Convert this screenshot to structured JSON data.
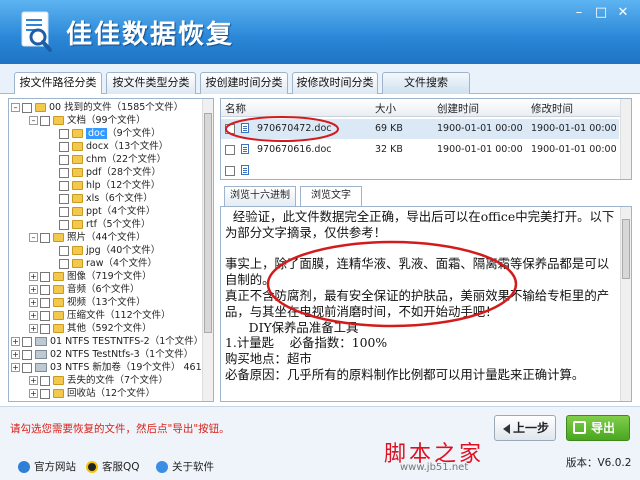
{
  "app": {
    "title": "佳佳数据恢复",
    "window_buttons": [
      "–",
      "□",
      "✕"
    ]
  },
  "tabs": [
    {
      "label": "按文件路径分类",
      "active": true
    },
    {
      "label": "按文件类型分类",
      "active": false
    },
    {
      "label": "按创建时间分类",
      "active": false
    },
    {
      "label": "按修改时间分类",
      "active": false
    },
    {
      "label": "文件搜索",
      "active": false
    }
  ],
  "tree": {
    "rows": [
      {
        "level": 0,
        "toggle": "–",
        "icon": "folder",
        "label": "00 找到的文件",
        "count": "（1585个文件）"
      },
      {
        "level": 1,
        "toggle": "–",
        "icon": "folder",
        "label": "文档",
        "count": "（99个文件）"
      },
      {
        "level": 2,
        "toggle": "",
        "icon": "folder",
        "label": "doc",
        "count": "（9个文件）",
        "selected": true
      },
      {
        "level": 2,
        "toggle": "",
        "icon": "folder",
        "label": "docx",
        "count": "（13个文件）"
      },
      {
        "level": 2,
        "toggle": "",
        "icon": "folder",
        "label": "chm",
        "count": "（22个文件）"
      },
      {
        "level": 2,
        "toggle": "",
        "icon": "folder",
        "label": "pdf",
        "count": "（28个文件）"
      },
      {
        "level": 2,
        "toggle": "",
        "icon": "folder",
        "label": "hlp",
        "count": "（12个文件）"
      },
      {
        "level": 2,
        "toggle": "",
        "icon": "folder",
        "label": "xls",
        "count": "（6个文件）"
      },
      {
        "level": 2,
        "toggle": "",
        "icon": "folder",
        "label": "ppt",
        "count": "（4个文件）"
      },
      {
        "level": 2,
        "toggle": "",
        "icon": "folder",
        "label": "rtf",
        "count": "（5个文件）"
      },
      {
        "level": 1,
        "toggle": "–",
        "icon": "folder",
        "label": "照片",
        "count": "（44个文件）"
      },
      {
        "level": 2,
        "toggle": "",
        "icon": "folder",
        "label": "jpg",
        "count": "（40个文件）"
      },
      {
        "level": 2,
        "toggle": "",
        "icon": "folder",
        "label": "raw",
        "count": "（4个文件）"
      },
      {
        "level": 1,
        "toggle": "+",
        "icon": "folder",
        "label": "图像",
        "count": "（719个文件）"
      },
      {
        "level": 1,
        "toggle": "+",
        "icon": "folder",
        "label": "音频",
        "count": "（6个文件）"
      },
      {
        "level": 1,
        "toggle": "+",
        "icon": "folder",
        "label": "视频",
        "count": "（13个文件）"
      },
      {
        "level": 1,
        "toggle": "+",
        "icon": "folder",
        "label": "压缩文件",
        "count": "（112个文件）"
      },
      {
        "level": 1,
        "toggle": "+",
        "icon": "folder",
        "label": "其他",
        "count": "（592个文件）"
      },
      {
        "level": 0,
        "toggle": "+",
        "icon": "drive",
        "label": "01 NTFS TESTNTFS-2",
        "count": "（1个文件）"
      },
      {
        "level": 0,
        "toggle": "+",
        "icon": "drive",
        "label": "02 NTFS TestNtfs-3",
        "count": "（1个文件）"
      },
      {
        "level": 0,
        "toggle": "+",
        "icon": "drive",
        "label": "03 NTFS 新加卷",
        "count": "（19个文件） 461"
      },
      {
        "level": 1,
        "toggle": "+",
        "icon": "folder",
        "label": "丢失的文件",
        "count": "（7个文件）"
      },
      {
        "level": 1,
        "toggle": "+",
        "icon": "folder",
        "label": "回收站",
        "count": "（12个文件）"
      }
    ]
  },
  "filelist": {
    "columns": [
      "名称",
      "大小",
      "创建时间",
      "修改时间"
    ],
    "rows": [
      {
        "name": "970670472.doc",
        "size": "69 KB",
        "created": "1900-01-01 00:00",
        "modified": "1900-01-01 00:00",
        "highlight": true
      },
      {
        "name": "970670616.doc",
        "size": "32 KB",
        "created": "1900-01-01 00:00",
        "modified": "1900-01-01 00:00",
        "highlight": false
      },
      {
        "name": "",
        "size": "",
        "created": "",
        "modified": "",
        "highlight": false
      }
    ]
  },
  "preview": {
    "tabs": [
      "浏览十六进制",
      "浏览文字"
    ],
    "active_tab": 1,
    "text": "  经验证，此文件数据完全正确，导出后可以在office中完美打开。以下为部分文字摘录，仅供参考！\n\n事实上，除了面膜，连精华液、乳液、面霜、隔离霜等保养品都是可以自制的。\n真正不含防腐剂，最有安全保证的护肤品，美丽效果不输给专柜里的产品，与其坐在电视前消磨时间，不如开始动手吧！\n      DIY保养品准备工具\n1.计量匙    必备指数：100%\n购买地点：超市\n必备原因：几乎所有的原料制作比例都可以用计量匙来正确计算。"
  },
  "footer": {
    "hint": "请勾选您需要恢复的文件，然后点\"导出\"按钮。",
    "prev_label": "上一步",
    "export_label": "导出",
    "links": [
      {
        "label": "官方网站",
        "icon": "ie-icon"
      },
      {
        "label": "客服QQ",
        "icon": "qq-icon"
      },
      {
        "label": "关于软件",
        "icon": "info-icon"
      }
    ],
    "version_label": "版本：",
    "version": "V6.0.2",
    "watermark": "脚本之家",
    "watermark_url": "www.jb51.net"
  }
}
